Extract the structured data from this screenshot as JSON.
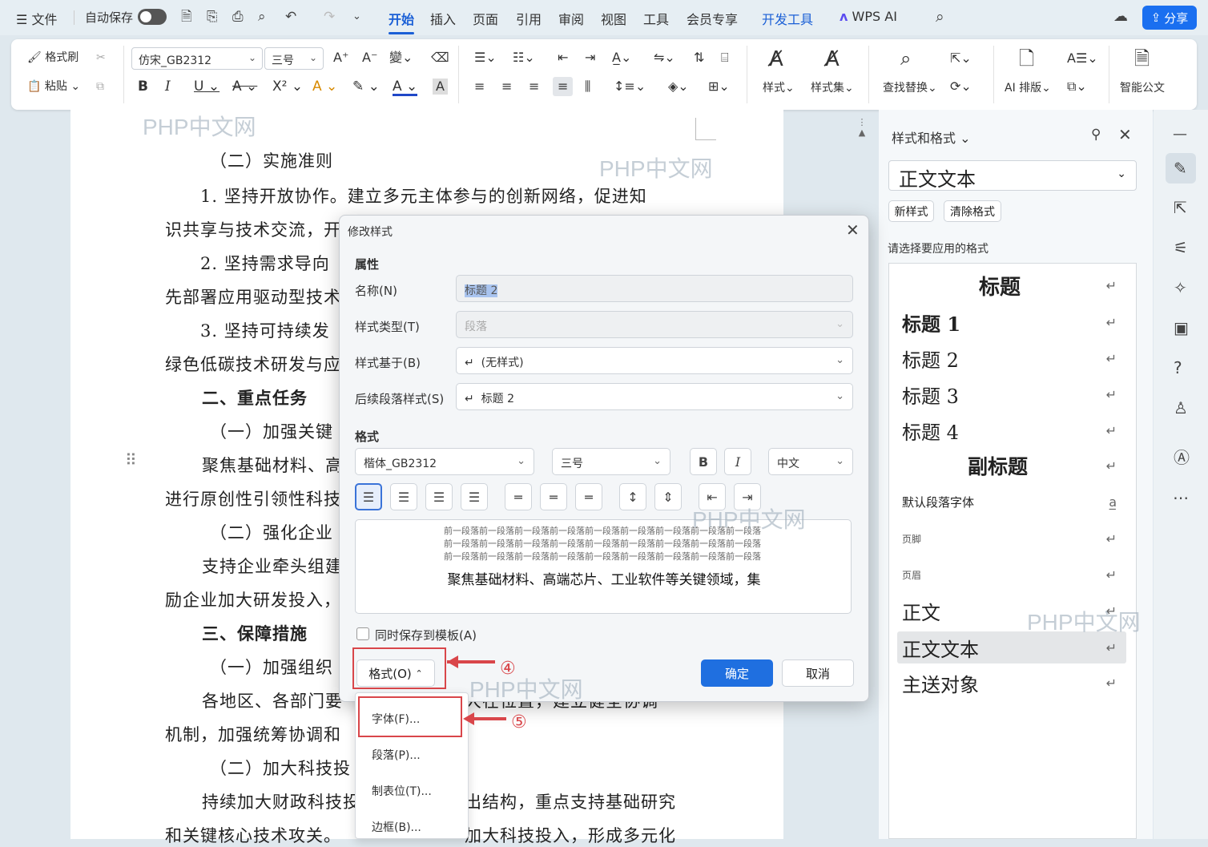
{
  "menubar": {
    "file": "文件",
    "autosave": "自动保存",
    "tabs": [
      "开始",
      "插入",
      "页面",
      "引用",
      "审阅",
      "视图",
      "工具",
      "会员专享",
      "开发工具"
    ],
    "wps_ai": "WPS AI",
    "share": "分享"
  },
  "ribbon": {
    "format_painter": "格式刷",
    "paste": "粘贴",
    "font_name": "仿宋_GB2312",
    "font_size": "三号",
    "styles": "样式",
    "style_set": "样式集",
    "find_replace": "查找替换",
    "ai_layout": "AI 排版",
    "smart_doc": "智能公文",
    "bold": "B",
    "italic": "I",
    "underline": "U"
  },
  "document": {
    "lines": [
      "（二）实施准则",
      "1. 坚持开放协作。建立多元主体参与的创新网络，促进知",
      "识共享与技术交流，开",
      "2. 坚持需求导向",
      "先部署应用驱动型技术",
      "3. 坚持可持续发",
      "绿色低碳技术研发与应",
      "二、重点任务",
      "（一）加强关键",
      "聚焦基础材料、高",
      "进行原创性引领性科技",
      "（二）强化企业",
      "支持企业牵头组建",
      "励企业加大研发投入，",
      "三、保障措施",
      "（一）加强组织",
      "各地区、各部门要",
      "机制，加强统筹协调和",
      "（二）加大科技投",
      "持续加大财政科技投",
      "和关键核心技术攻关。"
    ],
    "tail_lines": [
      "大在位置，建立健全协调",
      "出结构，重点支持基础研究",
      "加大科技投入，形成多元化"
    ],
    "watermark": "PHP中文网"
  },
  "panel": {
    "title": "样式和格式",
    "current_style": "正文文本",
    "new_style": "新样式",
    "clear_format": "清除格式",
    "hint": "请选择要应用的格式",
    "styles": [
      "标题",
      "标题 1",
      "标题 2",
      "标题 3",
      "标题 4",
      "副标题",
      "默认段落字体",
      "页脚",
      "页眉",
      "正文",
      "正文文本",
      "主送对象"
    ]
  },
  "dialog": {
    "title": "修改样式",
    "section_props": "属性",
    "name_label": "名称(N)",
    "name_value": "标题 2",
    "type_label": "样式类型(T)",
    "type_value": "段落",
    "based_label": "样式基于(B)",
    "based_value": "(无样式)",
    "next_label": "后续段落样式(S)",
    "next_value": "标题 2",
    "section_format": "格式",
    "font": "楷体_GB2312",
    "size": "三号",
    "bold": "B",
    "italic": "I",
    "lang": "中文",
    "preview_prev": "前一段落前一段落前一段落前一段落前一段落前一段落前一段落前一段落前一段落",
    "preview_text": "聚焦基础材料、高端芯片、工业软件等关键领域，集",
    "save_template": "同时保存到模板(A)",
    "format_btn": "格式(O)",
    "ok": "确定",
    "cancel": "取消",
    "step4": "④",
    "step5": "⑤"
  },
  "menu": {
    "items": [
      "字体(F)...",
      "段落(P)...",
      "制表位(T)...",
      "边框(B)..."
    ]
  },
  "colors": {
    "accent": "#1a6ff0",
    "highlight": "#d9464a"
  }
}
